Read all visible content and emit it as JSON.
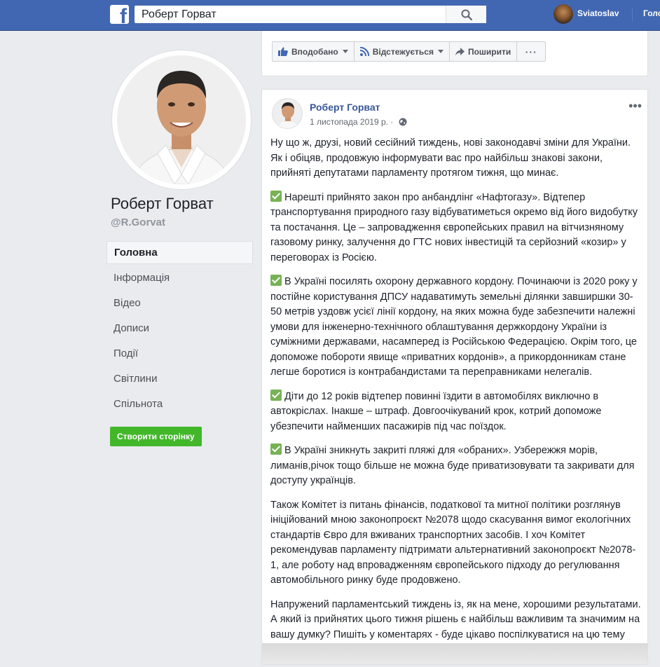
{
  "topbar": {
    "search_value": "Роберт Горват",
    "username": "Sviatoslav",
    "nav_home": "Головна"
  },
  "page": {
    "name": "Роберт Горват",
    "handle": "@R.Gorvat"
  },
  "left_nav": {
    "items": [
      "Головна",
      "Інформація",
      "Відео",
      "Дописи",
      "Події",
      "Світлини",
      "Спільнота"
    ],
    "active_index": 0
  },
  "create_page_label": "Створити сторінку",
  "actions": {
    "liked_label": "Вподобано",
    "following_label": "Відстежується",
    "share_label": "Поширити",
    "more_label": "···"
  },
  "post": {
    "author": "Роберт Горват",
    "date": "1 листопада 2019 р. ·",
    "menu": "•••",
    "paragraphs": [
      "Ну що ж, друзі, новий сесійний тиждень, нові законодавчі зміни для України. Як і обіцяв, продовжую інформувати вас про найбільш знакові закони, прийняті депутатами парламенту протягом тижня, що минає.",
      "Нарешті прийнято закон про анбандлінг «Нафтогазу». Відтепер транспортування природного газу відбуватиметься окремо від його видобутку та постачання. Це – запровадження європейських правил на вітчизняному газовому ринку, залучення до ГТС нових інвестицій та серйозний «козир» у переговорах із Росією.",
      "В Україні посилять охорону державного кордону. Починаючи із 2020 року у постійне користування ДПСУ надаватимуть земельні ділянки завширшки 30-50 метрів уздовж усієї лінії кордону, на яких можна буде забезпечити належні умови для інженерно-технічного облаштування держкордону України із суміжними державами, насамперед із Російською Федерацією. Окрім того, це допоможе побороти явище «приватних кордонів», а прикордонникам стане легше боротися із контрабандистами та переправниками нелегалів.",
      "Діти до 12 років відтепер повинні їздити в автомобілях виключно в автокріслах. Інакше – штраф. Довгоочікуваний крок, котрий допоможе убезпечити найменших пасажирів під час поїздок.",
      "В Україні зникнуть закриті пляжі для «обраних». Узбережжя морів, лиманів,річок тощо більше не можна буде приватизовувати та закривати для доступу українців.",
      "Також Комітет із питань фінансів, податкової та митної політики розглянув ініційований мною законопроєкт №2078 щодо скасування вимог екологічних стандартів Євро для вживаних транспортних засобів. І хоч Комітет рекомендував парламенту підтримати альтернативний законопроєкт №2078-1, але роботу над впровадженням європейського підходу до регулювання автомобільного ринку буде продовжено.",
      "Напружений парламентський тиждень із, як на мене, хорошими результатами. А який із прийнятих цього тижня рішень є найбільш важливим та значимим на вашу думку? Пишіть у коментарях - буде цікаво поспілкуватися на цю тему більш детально"
    ]
  },
  "colors": {
    "topbar": "#4267b2",
    "link": "#385898",
    "create_button": "#42b72a",
    "checkmark": "#77b255"
  },
  "icons": {
    "logo": "facebook-logo-icon",
    "search": "search-icon",
    "like": "thumbs-up-icon",
    "follow": "rss-icon",
    "share": "share-arrow-icon",
    "globe": "globe-icon",
    "check": "check-box-icon",
    "smile": "smile-emoji-icon"
  }
}
